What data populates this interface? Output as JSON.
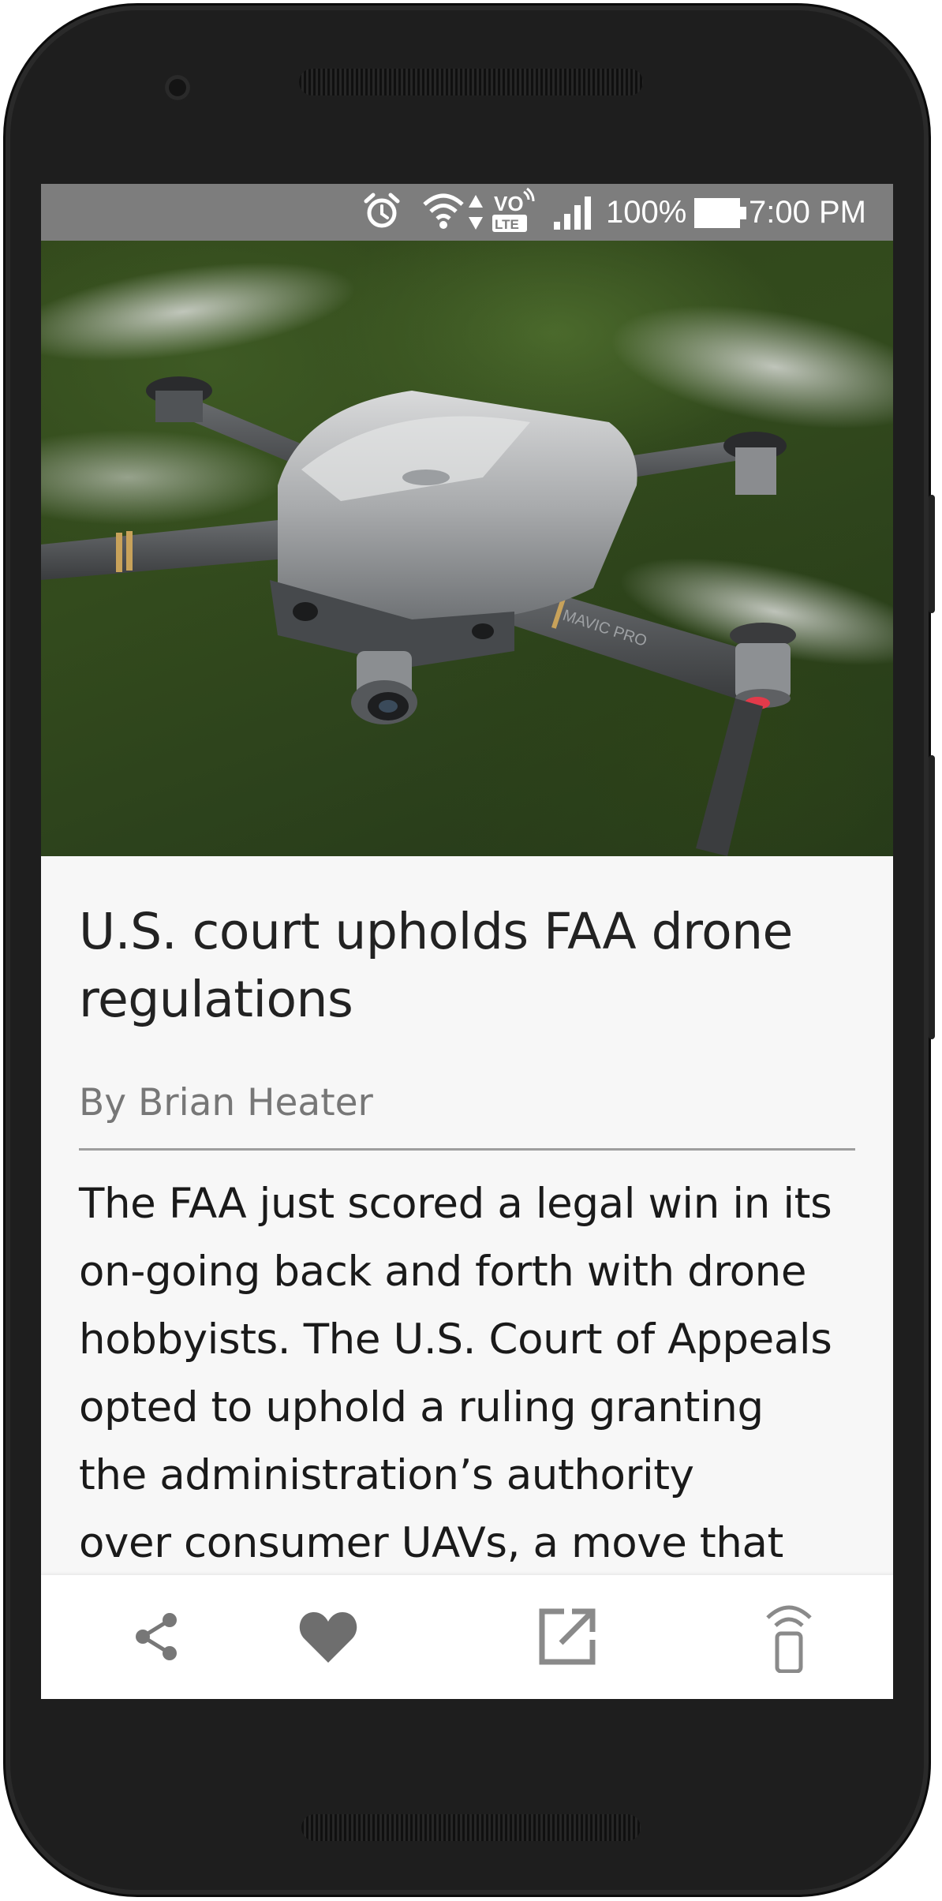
{
  "status_bar": {
    "battery_percent": "100%",
    "time": "7:00 PM",
    "network_badge_top": "VO",
    "network_badge_bottom": "LTE",
    "icons": [
      "alarm-icon",
      "wifi-icon",
      "data-arrows-icon",
      "volte-icon",
      "signal-icon",
      "battery-icon"
    ]
  },
  "article": {
    "image_alt": "DJI Mavic Pro drone in flight",
    "drone_brand_text": "MAVIC PRO",
    "title_line1": "U.S. court upholds FAA drone",
    "title_line2": "regulations",
    "byline": "By Brian Heater",
    "body_lines": [
      "The FAA just scored a legal win in its",
      "on-going back and forth with drone",
      "hobbyists. The U.S. Court of Appeals",
      "opted to uphold a ruling granting",
      "the administration’s authority",
      "over consumer UAVs, a move that"
    ]
  },
  "bottom_bar": {
    "actions": [
      "share-icon",
      "heart-icon",
      "open-external-icon",
      "cast-to-device-icon"
    ]
  },
  "colors": {
    "status_bar_bg": "#7d7d7d",
    "content_bg": "#f7f7f7",
    "title_color": "#222222",
    "byline_color": "#777777",
    "icon_gray": "#8a8a8a",
    "heart_color": "#6e6e6e"
  }
}
